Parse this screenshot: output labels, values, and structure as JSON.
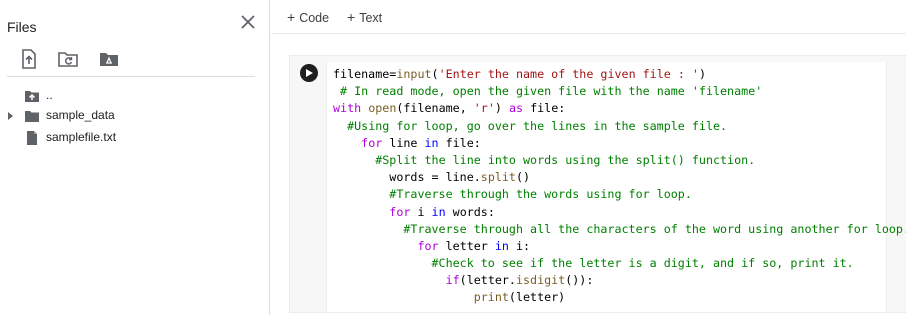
{
  "sidebar": {
    "title": "Files",
    "toolbar": [
      {
        "icon": "upload-file-icon"
      },
      {
        "icon": "refresh-folder-icon"
      },
      {
        "icon": "mount-drive-icon"
      }
    ],
    "tree": [
      {
        "label": "..",
        "icon": "parent-folder-icon",
        "expandable": false
      },
      {
        "label": "sample_data",
        "icon": "folder-icon",
        "expandable": true
      },
      {
        "label": "samplefile.txt",
        "icon": "file-icon",
        "expandable": false
      }
    ]
  },
  "topbar": {
    "add_code_label": "Code",
    "add_text_label": "Text",
    "plus": "+"
  },
  "cell": {
    "code_lines": [
      [
        [
          "filename=",
          "plain"
        ],
        [
          "input",
          "fn"
        ],
        [
          "(",
          "plain"
        ],
        [
          "'Enter the name of the given file : '",
          "str"
        ],
        [
          ")",
          "plain"
        ]
      ],
      [
        [
          " ",
          "plain"
        ],
        [
          "# In read mode, open the given file with the name 'filename'",
          "com"
        ]
      ],
      [
        [
          "with",
          "kw2"
        ],
        [
          " ",
          "plain"
        ],
        [
          "open",
          "fn"
        ],
        [
          "(filename, ",
          "plain"
        ],
        [
          "'r'",
          "str"
        ],
        [
          ") ",
          "plain"
        ],
        [
          "as",
          "kw2"
        ],
        [
          " file:",
          "plain"
        ]
      ],
      [
        [
          "  ",
          "plain"
        ],
        [
          "#Using for loop, go over the lines in the sample file.",
          "com"
        ]
      ],
      [
        [
          "    ",
          "plain"
        ],
        [
          "for",
          "kw2"
        ],
        [
          " line ",
          "plain"
        ],
        [
          "in",
          "kw"
        ],
        [
          " file:",
          "plain"
        ]
      ],
      [
        [
          "      ",
          "plain"
        ],
        [
          "#Split the line into words using the split() function.",
          "com"
        ]
      ],
      [
        [
          "        words = line.",
          "plain"
        ],
        [
          "split",
          "fn"
        ],
        [
          "()",
          "plain"
        ]
      ],
      [
        [
          "        ",
          "plain"
        ],
        [
          "#Traverse through the words using for loop.",
          "com"
        ]
      ],
      [
        [
          "        ",
          "plain"
        ],
        [
          "for",
          "kw2"
        ],
        [
          " i ",
          "plain"
        ],
        [
          "in",
          "kw"
        ],
        [
          " words:",
          "plain"
        ]
      ],
      [
        [
          "          ",
          "plain"
        ],
        [
          "#Traverse through all the characters of the word using another for loop.",
          "com"
        ]
      ],
      [
        [
          "            ",
          "plain"
        ],
        [
          "for",
          "kw2"
        ],
        [
          " letter ",
          "plain"
        ],
        [
          "in",
          "kw"
        ],
        [
          " i:",
          "plain"
        ]
      ],
      [
        [
          "              ",
          "plain"
        ],
        [
          "#Check to see if the letter is a digit, and if so, print it.",
          "com"
        ]
      ],
      [
        [
          "                ",
          "plain"
        ],
        [
          "if",
          "kw2"
        ],
        [
          "(letter.",
          "plain"
        ],
        [
          "isdigit",
          "fn"
        ],
        [
          "()):",
          "plain"
        ]
      ],
      [
        [
          "                    ",
          "plain"
        ],
        [
          "print",
          "fn"
        ],
        [
          "(letter)",
          "plain"
        ]
      ]
    ]
  },
  "colors": {
    "keyword_control": "#af00db",
    "keyword_operator": "#0000ff",
    "string": "#a31515",
    "comment": "#008000",
    "function": "#795e26",
    "icon_gray": "#5f6368"
  }
}
